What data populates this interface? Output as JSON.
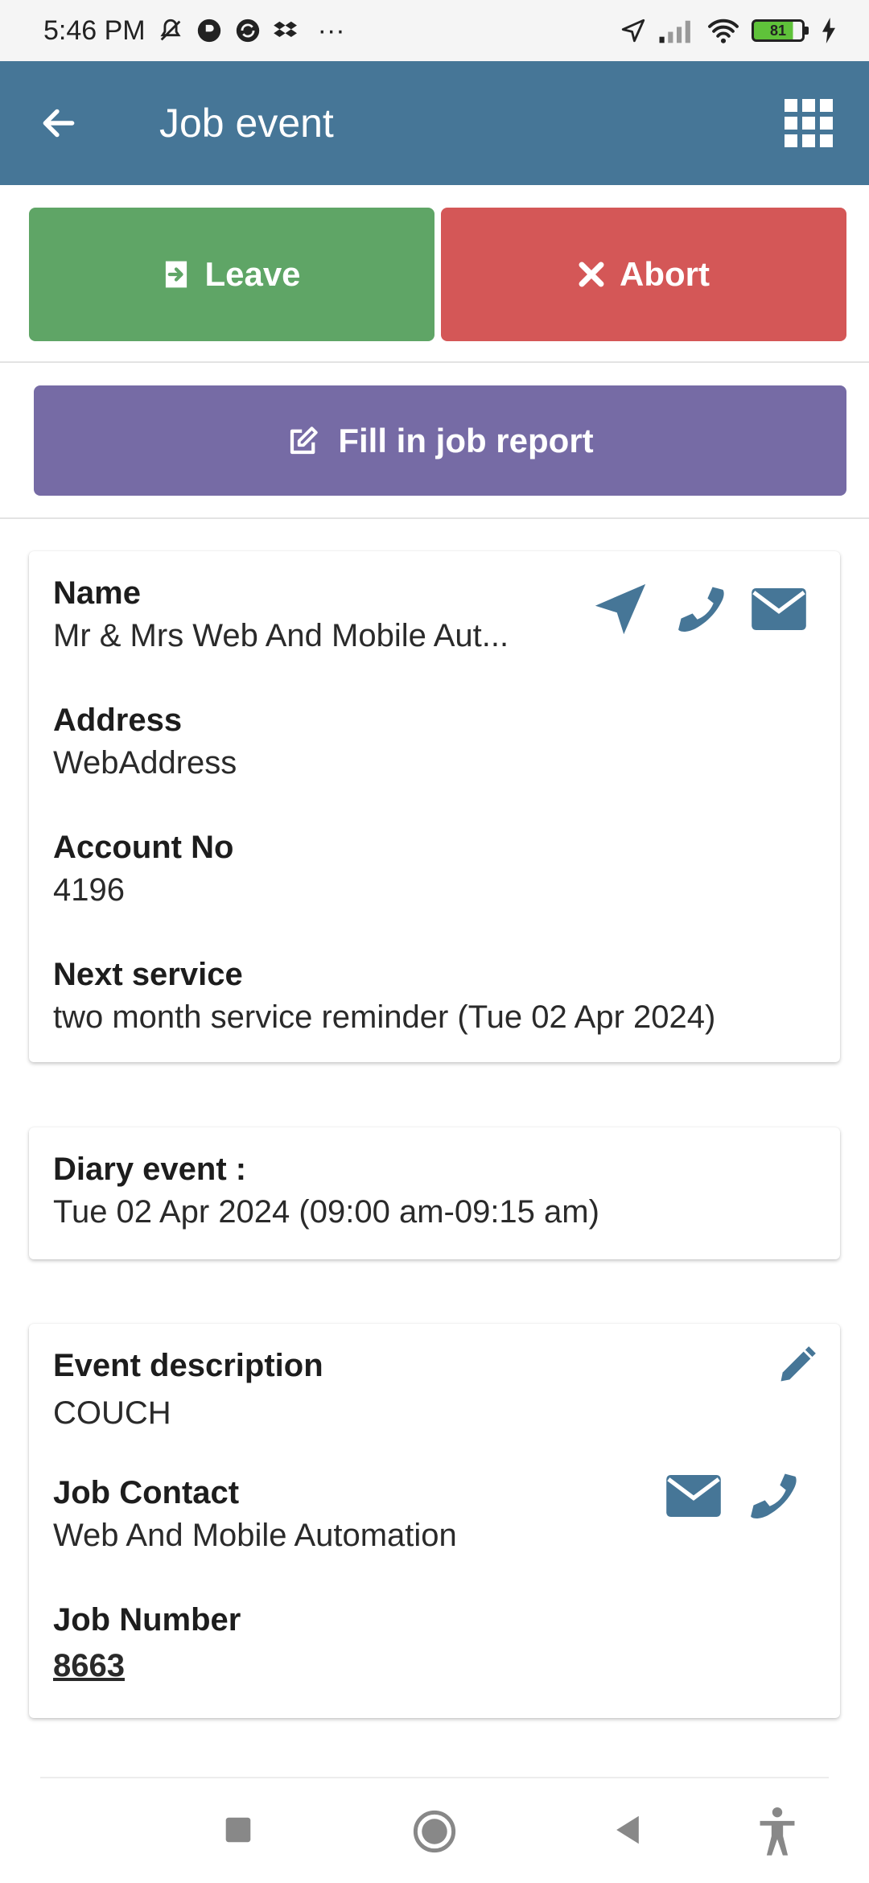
{
  "status_bar": {
    "time": "5:46 PM",
    "more": "···",
    "battery": "81",
    "battery_level": 81
  },
  "app_bar": {
    "title": "Job event",
    "back_icon": "arrow-left-icon",
    "menu_icon": "grid-menu-icon"
  },
  "actions": {
    "leave_label": "Leave",
    "abort_label": "Abort",
    "report_label": "Fill in job report"
  },
  "customer": {
    "name_label": "Name",
    "name_value": "Mr & Mrs Web And Mobile Aut...",
    "address_label": "Address",
    "address_value": "WebAddress",
    "account_label": "Account No",
    "account_value": "4196",
    "next_service_label": "Next service",
    "next_service_value": "two month service reminder (Tue 02 Apr 2024)"
  },
  "diary": {
    "label": "Diary event :",
    "value": "Tue 02 Apr 2024 (09:00 am-09:15 am)"
  },
  "event": {
    "description_label": "Event description",
    "description_value": "COUCH",
    "contact_label": "Job Contact",
    "contact_value": "Web And Mobile Automation",
    "job_number_label": "Job Number",
    "job_number_value": "8663"
  },
  "colors": {
    "app_bar": "#467697",
    "leave": "#5fa566",
    "abort": "#d45757",
    "report": "#766ba5",
    "icon_blue": "#467697",
    "link": "#2aa6d8"
  }
}
